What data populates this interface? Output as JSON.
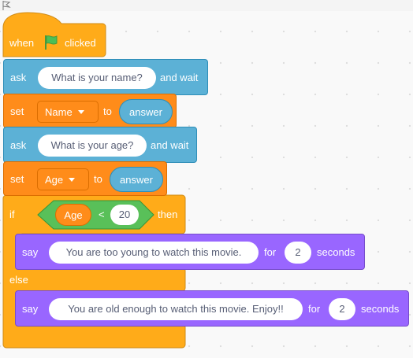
{
  "colors": {
    "events": "#ffab19",
    "sensing": "#5cb1d6",
    "variables": "#ff8c1a",
    "control": "#ffab19",
    "operators": "#59c059",
    "looks": "#9966ff"
  },
  "hat": {
    "when": "when",
    "icon": "green-flag-icon",
    "clicked": "clicked"
  },
  "ask1": {
    "keyword": "ask",
    "question": "What is your name?",
    "suffix": "and wait"
  },
  "set1": {
    "keyword": "set",
    "variable": "Name",
    "to": "to",
    "value": "answer"
  },
  "ask2": {
    "keyword": "ask",
    "question": "What is your age?",
    "suffix": "and wait"
  },
  "set2": {
    "keyword": "set",
    "variable": "Age",
    "to": "to",
    "value": "answer"
  },
  "if_block": {
    "if": "if",
    "condition": {
      "left": "Age",
      "operator": "<",
      "right": "20"
    },
    "then": "then",
    "else": "else"
  },
  "say1": {
    "keyword": "say",
    "message": "You are too young to watch this movie.",
    "for": "for",
    "secs": "2",
    "unit": "seconds"
  },
  "say2": {
    "keyword": "say",
    "message": "You are old enough to watch this movie. Enjoy!!",
    "for": "for",
    "secs": "2",
    "unit": "seconds"
  }
}
